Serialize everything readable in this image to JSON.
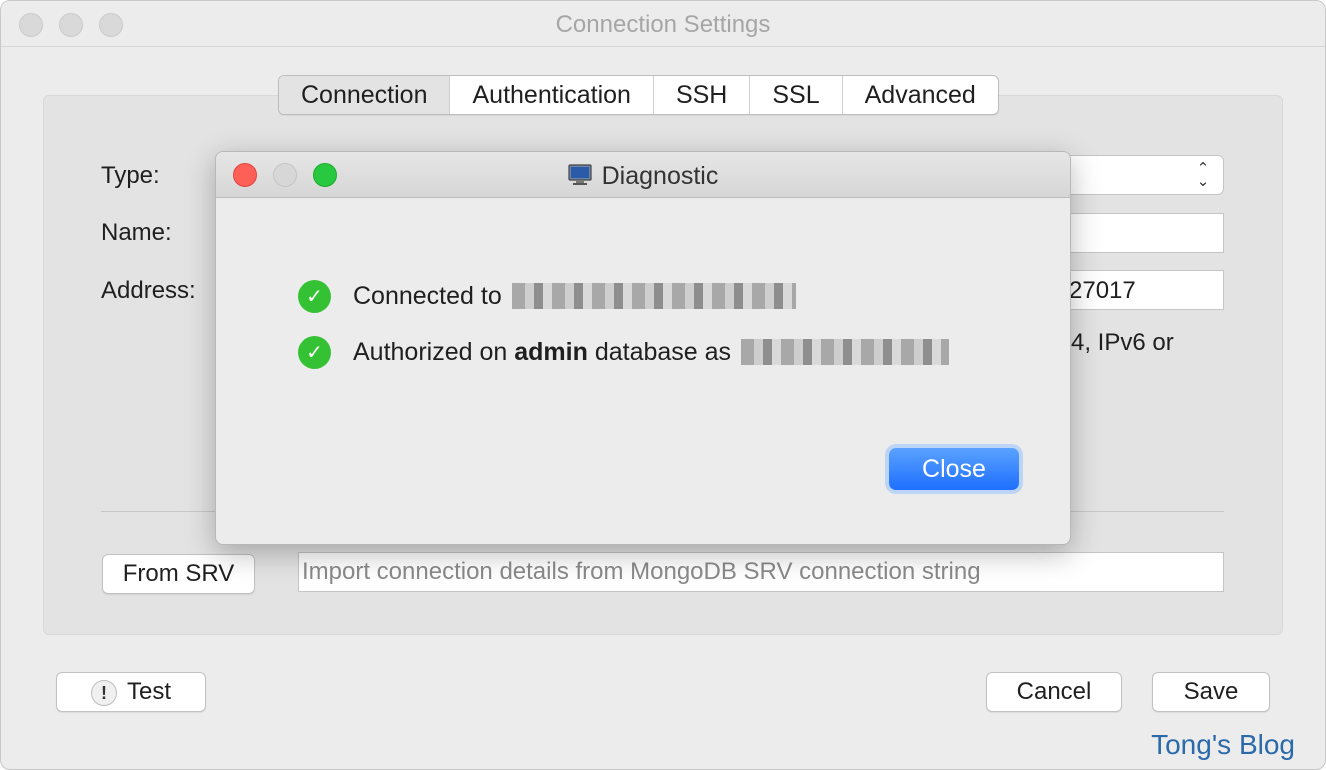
{
  "window": {
    "title": "Connection Settings"
  },
  "tabs": [
    {
      "label": "Connection",
      "active": true
    },
    {
      "label": "Authentication",
      "active": false
    },
    {
      "label": "SSH",
      "active": false
    },
    {
      "label": "SSL",
      "active": false
    },
    {
      "label": "Advanced",
      "active": false
    }
  ],
  "form": {
    "type_label": "Type:",
    "name_label": "Name:",
    "address_label": "Address:",
    "address_port_value": "27017",
    "address_hint": "4, IPv6 or"
  },
  "srv": {
    "button_label": "From SRV",
    "placeholder": "Import connection details from MongoDB SRV connection string"
  },
  "footer": {
    "test_label": "Test",
    "cancel_label": "Cancel",
    "save_label": "Save"
  },
  "watermark": "Tong's Blog",
  "dialog": {
    "title": "Diagnostic",
    "row1_text": "Connected to",
    "row2_prefix": "Authorized on",
    "row2_bold": "admin",
    "row2_suffix": "database as",
    "close_label": "Close"
  },
  "colors": {
    "accent_blue": "#1e6fff",
    "success_green": "#34c134",
    "close_red": "#fe5f57",
    "zoom_green": "#28c840"
  }
}
